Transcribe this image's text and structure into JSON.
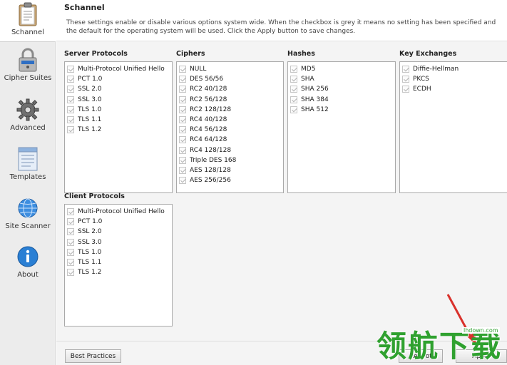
{
  "sidebar": {
    "items": [
      {
        "label": "Schannel",
        "icon": "clipboard-icon"
      },
      {
        "label": "Cipher Suites",
        "icon": "padlock-icon"
      },
      {
        "label": "Advanced",
        "icon": "gear-icon"
      },
      {
        "label": "Templates",
        "icon": "templates-icon"
      },
      {
        "label": "Site Scanner",
        "icon": "globe-icon"
      },
      {
        "label": "About",
        "icon": "info-icon"
      }
    ],
    "active": "Schannel"
  },
  "header": {
    "title": "Schannel",
    "description": "These settings enable or disable various options system wide. When the checkbox is grey it means no setting has been specified and the default for the operating system will be used. Click the Apply button to save changes."
  },
  "groups": {
    "server_protocols": {
      "title": "Server Protocols",
      "items": [
        "Multi-Protocol Unified Hello",
        "PCT 1.0",
        "SSL 2.0",
        "SSL 3.0",
        "TLS 1.0",
        "TLS 1.1",
        "TLS 1.2"
      ]
    },
    "ciphers": {
      "title": "Ciphers",
      "items": [
        "NULL",
        "DES 56/56",
        "RC2 40/128",
        "RC2 56/128",
        "RC2 128/128",
        "RC4 40/128",
        "RC4 56/128",
        "RC4 64/128",
        "RC4 128/128",
        "Triple DES 168",
        "AES 128/128",
        "AES 256/256"
      ]
    },
    "hashes": {
      "title": "Hashes",
      "items": [
        "MD5",
        "SHA",
        "SHA 256",
        "SHA 384",
        "SHA 512"
      ]
    },
    "key_exchanges": {
      "title": "Key Exchanges",
      "items": [
        "Diffie-Hellman",
        "PKCS",
        "ECDH"
      ]
    },
    "client_protocols": {
      "title": "Client Protocols",
      "items": [
        "Multi-Protocol Unified Hello",
        "PCT 1.0",
        "SSL 2.0",
        "SSL 3.0",
        "TLS 1.0",
        "TLS 1.1",
        "TLS 1.2"
      ]
    }
  },
  "checkbox_state": "grey",
  "footer": {
    "best_practices_label": "Best Practices",
    "reboot_label": "Reboot",
    "apply_label": "Apply"
  },
  "watermark": {
    "text": "领航下载",
    "url": "lhdown.com"
  },
  "colors": {
    "sidebar_bg": "#ececec",
    "panel_bg": "#f4f4f4",
    "checkbox_grey": "#b4b4b4",
    "watermark_green": "#2fa12f",
    "arrow_red": "#d9312b"
  }
}
